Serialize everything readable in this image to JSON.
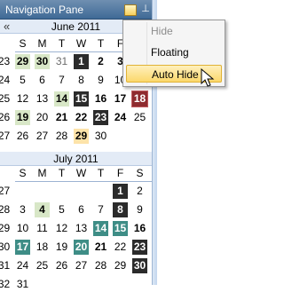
{
  "header": {
    "title": "Navigation Pane",
    "dropdown_icon": "dropdown-icon",
    "pin_icon": "pin-icon"
  },
  "menu": {
    "items": [
      {
        "label": "Hide",
        "mnemonic_underlined": "H",
        "state": "disabled"
      },
      {
        "label": "Floating",
        "mnemonic_underlined": "F",
        "state": "normal"
      },
      {
        "label": "Auto Hide",
        "mnemonic_underlined": "A",
        "state": "highlighted"
      }
    ]
  },
  "june": {
    "title": "June 2011",
    "prev_icon": "double-chevron-left-icon",
    "days_of_week": [
      "S",
      "M",
      "T",
      "W",
      "T",
      "F",
      "S"
    ],
    "weeks": [
      "23",
      "24",
      "25",
      "26",
      "27"
    ],
    "rows": [
      [
        "29",
        "30",
        "31",
        "1",
        "2",
        "3",
        "4"
      ],
      [
        "5",
        "6",
        "7",
        "8",
        "9",
        "10",
        "11"
      ],
      [
        "12",
        "13",
        "14",
        "15",
        "16",
        "17",
        "18"
      ],
      [
        "19",
        "20",
        "21",
        "22",
        "23",
        "24",
        "25"
      ],
      [
        "26",
        "27",
        "28",
        "29",
        "30",
        "",
        ""
      ]
    ]
  },
  "july": {
    "title": "July 2011",
    "days_of_week": [
      "S",
      "M",
      "T",
      "W",
      "T",
      "F",
      "S"
    ],
    "weeks": [
      "27",
      "28",
      "29",
      "30",
      "31",
      "32"
    ],
    "rows": [
      [
        "",
        "",
        "",
        "",
        "",
        "1",
        "2"
      ],
      [
        "3",
        "4",
        "5",
        "6",
        "7",
        "8",
        "9"
      ],
      [
        "10",
        "11",
        "12",
        "13",
        "14",
        "15",
        "16"
      ],
      [
        "17",
        "18",
        "19",
        "20",
        "21",
        "22",
        "23"
      ],
      [
        "24",
        "25",
        "26",
        "27",
        "28",
        "29",
        "30"
      ],
      [
        "31",
        "",
        "",
        "",
        "",
        "",
        ""
      ]
    ]
  },
  "colors": {
    "selected": "#2b2b2b",
    "today": "#8e2b2f",
    "teal_event": "#3e8d86",
    "green_busy": "#d8e7c7",
    "orange_busy": "#fde3a9",
    "menu_highlight": "#fbd86c"
  }
}
